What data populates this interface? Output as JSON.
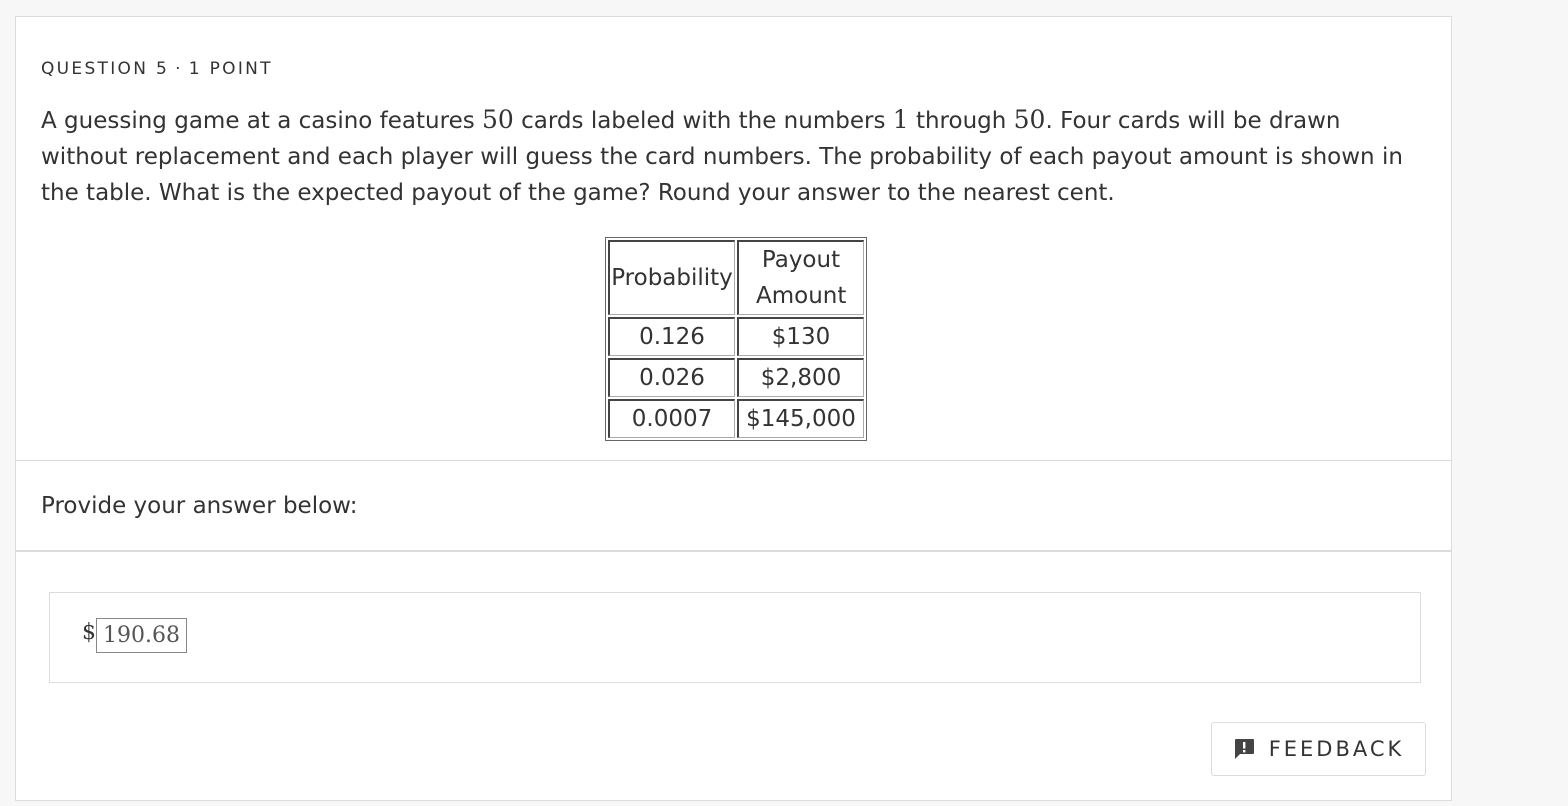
{
  "question": {
    "number_label": "QUESTION 5",
    "separator": "·",
    "points_label": "1 POINT",
    "text_parts": {
      "p1": "A guessing game at a casino features ",
      "m1": "50",
      "p2": " cards labeled with the numbers ",
      "m2": "1",
      "p3": " through ",
      "m3": "50",
      "p4": ". Four cards will be drawn without replacement and each player will guess the card numbers. The probability of each payout amount is shown in the table. What is the expected payout of the game? Round your answer to the nearest cent."
    }
  },
  "table": {
    "headers": [
      "Probability",
      "Payout Amount"
    ],
    "rows": [
      [
        "0.126",
        "$130"
      ],
      [
        "0.026",
        "$2,800"
      ],
      [
        "0.0007",
        "$145,000"
      ]
    ]
  },
  "answer": {
    "prompt": "Provide your answer below:",
    "currency_symbol": "$",
    "value": "190.68"
  },
  "feedback_button": {
    "label": "FEEDBACK",
    "icon": "feedback-alert-icon"
  }
}
